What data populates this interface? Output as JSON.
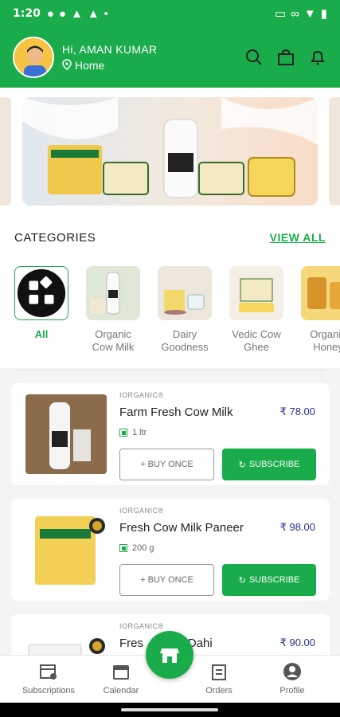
{
  "status": {
    "time": "1:20"
  },
  "header": {
    "greeting": "Hi, AMAN KUMAR",
    "location": "Home"
  },
  "categories": {
    "title": "CATEGORIES",
    "view_all": "VIEW ALL",
    "items": [
      {
        "label": "All",
        "active": true
      },
      {
        "label": "Organic Cow Milk"
      },
      {
        "label": "Dairy Goodness"
      },
      {
        "label": "Vedic Cow Ghee"
      },
      {
        "label": "Organic Honey"
      }
    ]
  },
  "products": [
    {
      "brand": "IORGANIC®",
      "title": "Farm Fresh Cow Milk",
      "price": "₹ 78.00",
      "qty": "1 ltr",
      "buy_once": "+ BUY ONCE",
      "subscribe": "SUBSCRIBE"
    },
    {
      "brand": "IORGANIC®",
      "title": "Fresh Cow Milk Paneer",
      "price": "₹ 98.00",
      "qty": "200 g",
      "buy_once": "+ BUY ONCE",
      "subscribe": "SUBSCRIBE"
    },
    {
      "brand": "IORGANIC®",
      "title": "Fres      Milk Dahi",
      "price": "₹ 90.00"
    }
  ],
  "nav": {
    "subscriptions": "Subscriptions",
    "calendar": "Calendar",
    "orders": "Orders",
    "profile": "Profile"
  },
  "colors": {
    "brand_green": "#1aab4a",
    "price_blue": "#23318a"
  }
}
